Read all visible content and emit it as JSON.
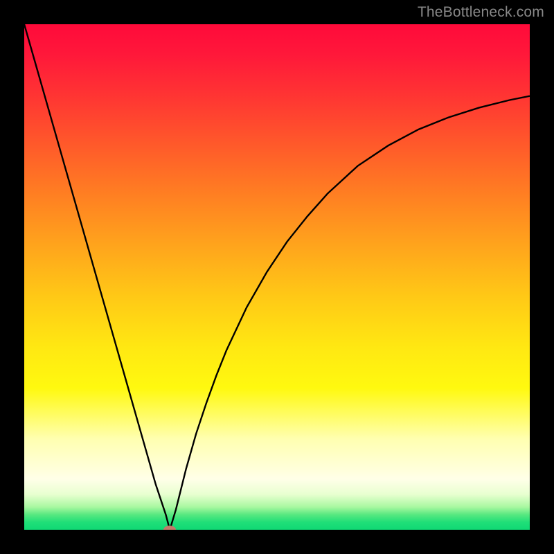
{
  "watermark": "TheBottleneck.com",
  "chart_data": {
    "type": "line",
    "title": "",
    "xlabel": "",
    "ylabel": "",
    "xlim": [
      0,
      100
    ],
    "ylim": [
      0,
      100
    ],
    "grid": false,
    "legend": false,
    "series": [
      {
        "name": "bottleneck-curve",
        "x": [
          0,
          4,
          8,
          12,
          16,
          20,
          24,
          26,
          28,
          28.8,
          30,
          32,
          34,
          36,
          38,
          40,
          44,
          48,
          52,
          56,
          60,
          66,
          72,
          78,
          84,
          90,
          96,
          100
        ],
        "y": [
          100,
          86,
          72,
          58,
          44,
          30,
          16,
          9,
          3,
          0,
          4,
          12,
          19,
          25,
          30.5,
          35.5,
          44,
          51,
          57,
          62,
          66.5,
          72,
          76,
          79.2,
          81.6,
          83.5,
          85,
          85.8
        ]
      }
    ],
    "marker": {
      "x": 28.8,
      "y": 0,
      "color": "#c47a6a"
    },
    "background_gradient": {
      "top": "#ff0a3a",
      "mid_orange": "#ffa51c",
      "yellow": "#fff90f",
      "pale": "#ffffe8",
      "green": "#10d874"
    }
  },
  "plot": {
    "inner_x": 35,
    "inner_y": 35,
    "inner_w": 730,
    "inner_h": 730
  }
}
